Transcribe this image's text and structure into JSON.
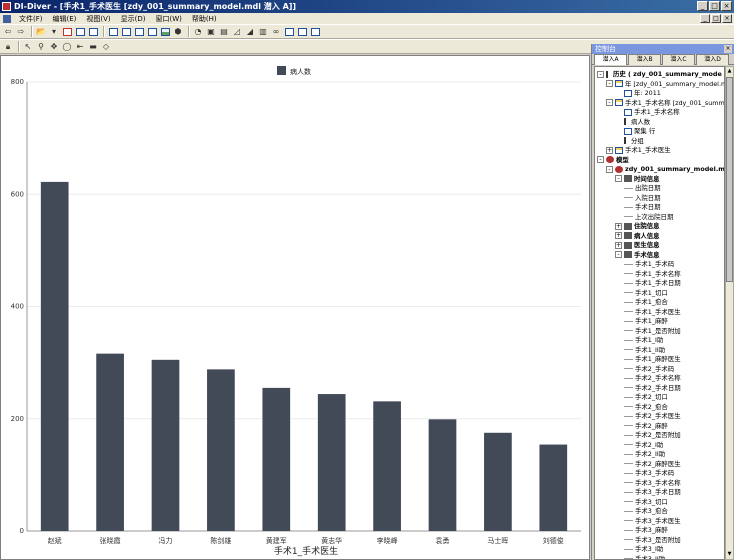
{
  "window": {
    "title": "DI-Diver - [手术1_手术医生 [zdy_001_summary_model.mdl 潜入 A]]",
    "controls": [
      "_",
      "□",
      "×"
    ]
  },
  "menu": [
    "文件(F)",
    "编辑(E)",
    "视图(V)",
    "显示(D)",
    "窗口(W)",
    "帮助(H)"
  ],
  "chart_data": {
    "type": "bar",
    "categories": [
      "赵斌",
      "张晓霞",
      "冯力",
      "陈剑雄",
      "黄建军",
      "黄志华",
      "李晓峰",
      "袁勇",
      "马士晖",
      "刘德俊"
    ],
    "series": [
      {
        "name": "病人数",
        "values": [
          622,
          316,
          305,
          288,
          255,
          244,
          231,
          199,
          175,
          154
        ],
        "color": "#424a58"
      }
    ],
    "xlabel": "手术1_手术医生",
    "ylabel": "",
    "yticks": [
      0,
      200,
      400,
      600,
      800
    ],
    "ylim": [
      0,
      800
    ],
    "grid": true,
    "legend": "top-center"
  },
  "panel": {
    "title": "控制台",
    "tabs": [
      "潜入A",
      "潜入B",
      "潜入C",
      "潜入D"
    ],
    "tree": [
      {
        "depth": 0,
        "text": "历史 ( zdy_001_summary_mode",
        "icon": "hist",
        "exp": "-",
        "bold": true
      },
      {
        "depth": 1,
        "text": "年 [zdy_001_summary_model.mdl]",
        "icon": "table",
        "exp": "-"
      },
      {
        "depth": 2,
        "text": "年: 2011",
        "icon": "grid",
        "exp": ""
      },
      {
        "depth": 1,
        "text": "手术1_手术名称 [zdy_001_summar",
        "icon": "table",
        "exp": "-"
      },
      {
        "depth": 2,
        "text": "手术1_手术名称",
        "icon": "grid",
        "exp": ""
      },
      {
        "depth": 2,
        "text": "病人数",
        "icon": "hist",
        "exp": ""
      },
      {
        "depth": 2,
        "text": "聚集 行",
        "icon": "grid",
        "exp": ""
      },
      {
        "depth": 2,
        "text": "分组",
        "icon": "hist",
        "exp": ""
      },
      {
        "depth": 1,
        "text": "手术1_手术医生",
        "icon": "table",
        "exp": "+"
      },
      {
        "depth": 0,
        "text": "模型",
        "icon": "ball",
        "exp": "-",
        "bold": true
      },
      {
        "depth": 1,
        "text": "zdy_001_summary_model.mdl",
        "icon": "ball",
        "exp": "-",
        "bold": true
      },
      {
        "depth": 2,
        "text": "时间信息",
        "icon": "folder",
        "exp": "-",
        "bold": true
      },
      {
        "depth": 3,
        "text": "出院日期",
        "icon": "",
        "exp": ""
      },
      {
        "depth": 3,
        "text": "入院日期",
        "icon": "",
        "exp": ""
      },
      {
        "depth": 3,
        "text": "手术日期",
        "icon": "",
        "exp": ""
      },
      {
        "depth": 3,
        "text": "上次出院日期",
        "icon": "",
        "exp": ""
      },
      {
        "depth": 2,
        "text": "住院信息",
        "icon": "folder",
        "exp": "+",
        "bold": true
      },
      {
        "depth": 2,
        "text": "病人信息",
        "icon": "folder",
        "exp": "+",
        "bold": true
      },
      {
        "depth": 2,
        "text": "医生信息",
        "icon": "folder",
        "exp": "+",
        "bold": true
      },
      {
        "depth": 2,
        "text": "手术信息",
        "icon": "folder",
        "exp": "-",
        "bold": true
      },
      {
        "depth": 3,
        "text": "手术1_手术码",
        "icon": "",
        "exp": ""
      },
      {
        "depth": 3,
        "text": "手术1_手术名称",
        "icon": "",
        "exp": ""
      },
      {
        "depth": 3,
        "text": "手术1_手术日期",
        "icon": "",
        "exp": ""
      },
      {
        "depth": 3,
        "text": "手术1_切口",
        "icon": "",
        "exp": ""
      },
      {
        "depth": 3,
        "text": "手术1_愈合",
        "icon": "",
        "exp": ""
      },
      {
        "depth": 3,
        "text": "手术1_手术医生",
        "icon": "",
        "exp": ""
      },
      {
        "depth": 3,
        "text": "手术1_麻醉",
        "icon": "",
        "exp": ""
      },
      {
        "depth": 3,
        "text": "手术1_是否附加",
        "icon": "",
        "exp": ""
      },
      {
        "depth": 3,
        "text": "手术1_I助",
        "icon": "",
        "exp": ""
      },
      {
        "depth": 3,
        "text": "手术1_II助",
        "icon": "",
        "exp": ""
      },
      {
        "depth": 3,
        "text": "手术1_麻醉医生",
        "icon": "",
        "exp": ""
      },
      {
        "depth": 3,
        "text": "手术2_手术码",
        "icon": "",
        "exp": ""
      },
      {
        "depth": 3,
        "text": "手术2_手术名称",
        "icon": "",
        "exp": ""
      },
      {
        "depth": 3,
        "text": "手术2_手术日期",
        "icon": "",
        "exp": ""
      },
      {
        "depth": 3,
        "text": "手术2_切口",
        "icon": "",
        "exp": ""
      },
      {
        "depth": 3,
        "text": "手术2_愈合",
        "icon": "",
        "exp": ""
      },
      {
        "depth": 3,
        "text": "手术2_手术医生",
        "icon": "",
        "exp": ""
      },
      {
        "depth": 3,
        "text": "手术2_麻醉",
        "icon": "",
        "exp": ""
      },
      {
        "depth": 3,
        "text": "手术2_是否附加",
        "icon": "",
        "exp": ""
      },
      {
        "depth": 3,
        "text": "手术2_I助",
        "icon": "",
        "exp": ""
      },
      {
        "depth": 3,
        "text": "手术2_II助",
        "icon": "",
        "exp": ""
      },
      {
        "depth": 3,
        "text": "手术2_麻醉医生",
        "icon": "",
        "exp": ""
      },
      {
        "depth": 3,
        "text": "手术3_手术码",
        "icon": "",
        "exp": ""
      },
      {
        "depth": 3,
        "text": "手术3_手术名称",
        "icon": "",
        "exp": ""
      },
      {
        "depth": 3,
        "text": "手术3_手术日期",
        "icon": "",
        "exp": ""
      },
      {
        "depth": 3,
        "text": "手术3_切口",
        "icon": "",
        "exp": ""
      },
      {
        "depth": 3,
        "text": "手术3_愈合",
        "icon": "",
        "exp": ""
      },
      {
        "depth": 3,
        "text": "手术3_手术医生",
        "icon": "",
        "exp": ""
      },
      {
        "depth": 3,
        "text": "手术3_麻醉",
        "icon": "",
        "exp": ""
      },
      {
        "depth": 3,
        "text": "手术3_是否附加",
        "icon": "",
        "exp": ""
      },
      {
        "depth": 3,
        "text": "手术3_I助",
        "icon": "",
        "exp": ""
      },
      {
        "depth": 3,
        "text": "手术3_II助",
        "icon": "",
        "exp": ""
      }
    ]
  }
}
